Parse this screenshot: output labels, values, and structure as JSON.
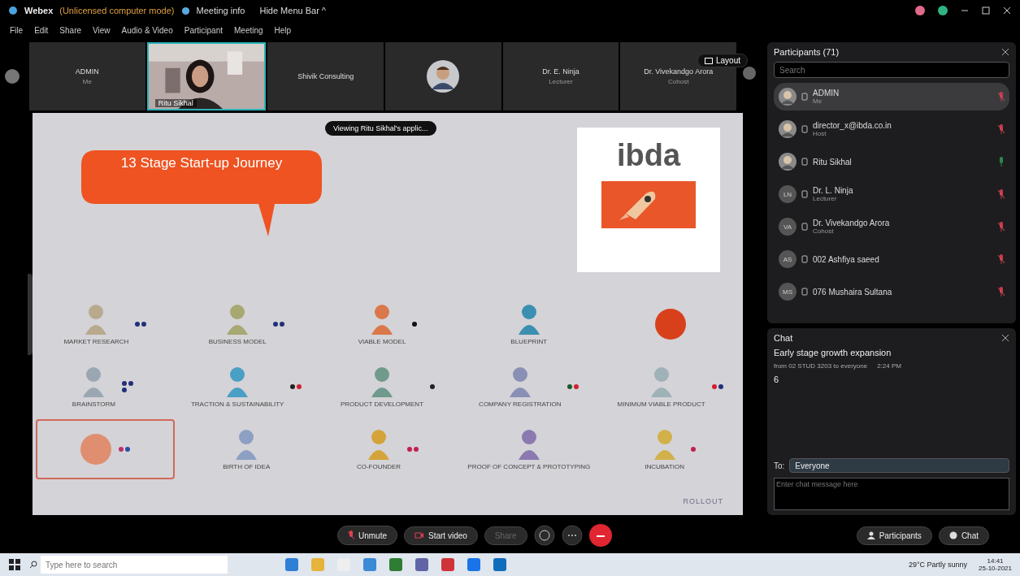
{
  "window": {
    "app": "Webex",
    "mode": "(Unlicensed computer mode)",
    "meeting_info": "Meeting info",
    "hide_menu": "Hide Menu Bar ^"
  },
  "menu": [
    "File",
    "Edit",
    "Share",
    "View",
    "Audio & Video",
    "Participant",
    "Meeting",
    "Help"
  ],
  "video_strip": [
    {
      "kind": "name",
      "name": "ADMIN",
      "role": "Me",
      "selected": false
    },
    {
      "kind": "video",
      "name": "Ritu Sikhal",
      "selected": true
    },
    {
      "kind": "name",
      "name": "Shivik Consulting",
      "selected": false
    },
    {
      "kind": "avatar",
      "selected": false
    },
    {
      "kind": "name",
      "name": "Dr. E. Ninja",
      "role": "Lecturer",
      "selected": false
    },
    {
      "kind": "name",
      "name": "Dr. Vivekandgo Arora",
      "role": "Cohost",
      "selected": false
    }
  ],
  "layout_button": "Layout",
  "share": {
    "banner": "Viewing Ritu Sikhal's applic...",
    "title": "13 Stage Start-up Journey",
    "logo": "ibda",
    "footer": "ROLLOUT",
    "stages": [
      {
        "kind": "figure",
        "label": "MARKET RESEARCH",
        "color": "#b9a98f",
        "selected": false,
        "dots": [
          {
            "color": "#22307a"
          },
          {
            "color": "#22307a"
          }
        ]
      },
      {
        "kind": "figure",
        "label": "BUSINESS MODEL",
        "color": "#a7a872",
        "selected": false,
        "dots": [
          {
            "color": "#22307a"
          },
          {
            "color": "#22307a"
          }
        ]
      },
      {
        "kind": "figure",
        "label": "VIABLE MODEL",
        "color": "#d9784a",
        "selected": false,
        "dots": [
          {
            "color": "#111111"
          }
        ]
      },
      {
        "kind": "figure",
        "label": "BLUEPRINT",
        "color": "#3b8fb0",
        "selected": false
      },
      {
        "kind": "circle",
        "color": "#d8401c",
        "selected": false
      },
      {
        "kind": "figure",
        "label": "BRAINSTORM",
        "color": "#9aa7b3",
        "selected": false,
        "dots": [
          {
            "color": "#22307a"
          },
          {
            "color": "#22307a"
          },
          {
            "color": "#22307a"
          }
        ]
      },
      {
        "kind": "figure",
        "label": "TRACTION & SUSTAINABILITY",
        "color": "#4a9fc4",
        "selected": false,
        "dots": [
          {
            "color": "#222222"
          },
          {
            "color": "#d02030"
          }
        ]
      },
      {
        "kind": "figure",
        "label": "PRODUCT DEVELOPMENT",
        "color": "#6f9a8c",
        "selected": false,
        "dots": [
          {
            "color": "#222222"
          }
        ]
      },
      {
        "kind": "figure",
        "label": "COMPANY REGISTRATION",
        "color": "#8a8fb5",
        "selected": false,
        "dots": [
          {
            "color": "#1c5a2c"
          },
          {
            "color": "#d02030"
          }
        ]
      },
      {
        "kind": "figure",
        "label": "MINIMUM VIABLE PRODUCT",
        "color": "#9fb2b8",
        "selected": false,
        "dots": [
          {
            "color": "#d02030"
          },
          {
            "color": "#22307a"
          }
        ]
      },
      {
        "kind": "circle",
        "color": "#e08e70",
        "selected": true,
        "dots": [
          {
            "color": "#c0306a"
          },
          {
            "color": "#2a4fa0"
          }
        ]
      },
      {
        "kind": "figure",
        "label": "BIRTH OF IDEA",
        "color": "#8e9fc4",
        "selected": false
      },
      {
        "kind": "figure",
        "label": "CO-FOUNDER",
        "color": "#d4a43a",
        "selected": false,
        "dots": [
          {
            "color": "#c02050"
          },
          {
            "color": "#c02050"
          }
        ]
      },
      {
        "kind": "figure",
        "label": "PROOF OF CONCEPT & PROTOTYPING",
        "color": "#8a7ab0",
        "selected": false
      },
      {
        "kind": "figure",
        "label": "INCUBATION",
        "color": "#d2b04a",
        "selected": false,
        "dots": [
          {
            "color": "#c02050"
          }
        ]
      }
    ]
  },
  "participants": {
    "title": "Participants (71)",
    "search": {
      "placeholder": "Search"
    },
    "items": [
      {
        "name": "ADMIN",
        "role": "Me",
        "muted": true,
        "selected": true
      },
      {
        "name": "director_x@ibda.co.in",
        "role": "Host",
        "muted": true,
        "selected": false
      },
      {
        "name": "Ritu Sikhal",
        "muted": false,
        "selected": false
      },
      {
        "kind": "initials",
        "initials": "LN",
        "name": "Dr. L. Ninja",
        "role": "Lecturer",
        "muted": true,
        "selected": false
      },
      {
        "kind": "initials",
        "initials": "VA",
        "name": "Dr. Vivekandgo Arora",
        "role": "Cohost",
        "muted": true,
        "selected": false
      },
      {
        "kind": "initials",
        "initials": "AS",
        "name": "002 Ashfiya saeed",
        "muted": true,
        "selected": false
      },
      {
        "kind": "initials",
        "initials": "MS",
        "name": "076 Mushaira Sultana",
        "muted": true,
        "selected": false
      }
    ]
  },
  "chat": {
    "title": "Chat",
    "message": "Early stage growth expansion",
    "meta": "from 02 STUD 3203 to everyone",
    "time": "2:24 PM",
    "reaction": "6",
    "to_label": "To:",
    "to_value": "Everyone",
    "input": {
      "placeholder": "Enter chat message here"
    }
  },
  "controls": {
    "unmute": "Unmute",
    "start_video": "Start video",
    "share": "Share",
    "participants": "Participants",
    "chat": "Chat"
  },
  "taskbar": {
    "search": {
      "placeholder": "Type here to search"
    },
    "apps": [
      {
        "color": "#2f7fd6"
      },
      {
        "color": "#e6b43a"
      },
      {
        "color": "#eeeeee"
      },
      {
        "color": "#3a8ad6"
      },
      {
        "color": "#2e7d32"
      },
      {
        "color": "#6264a7"
      },
      {
        "color": "#d13438"
      },
      {
        "color": "#1a73e8"
      },
      {
        "color": "#0f6cbd"
      }
    ],
    "weather": "29°C Partly sunny",
    "time": "14:41",
    "date": "25-10-2021"
  }
}
